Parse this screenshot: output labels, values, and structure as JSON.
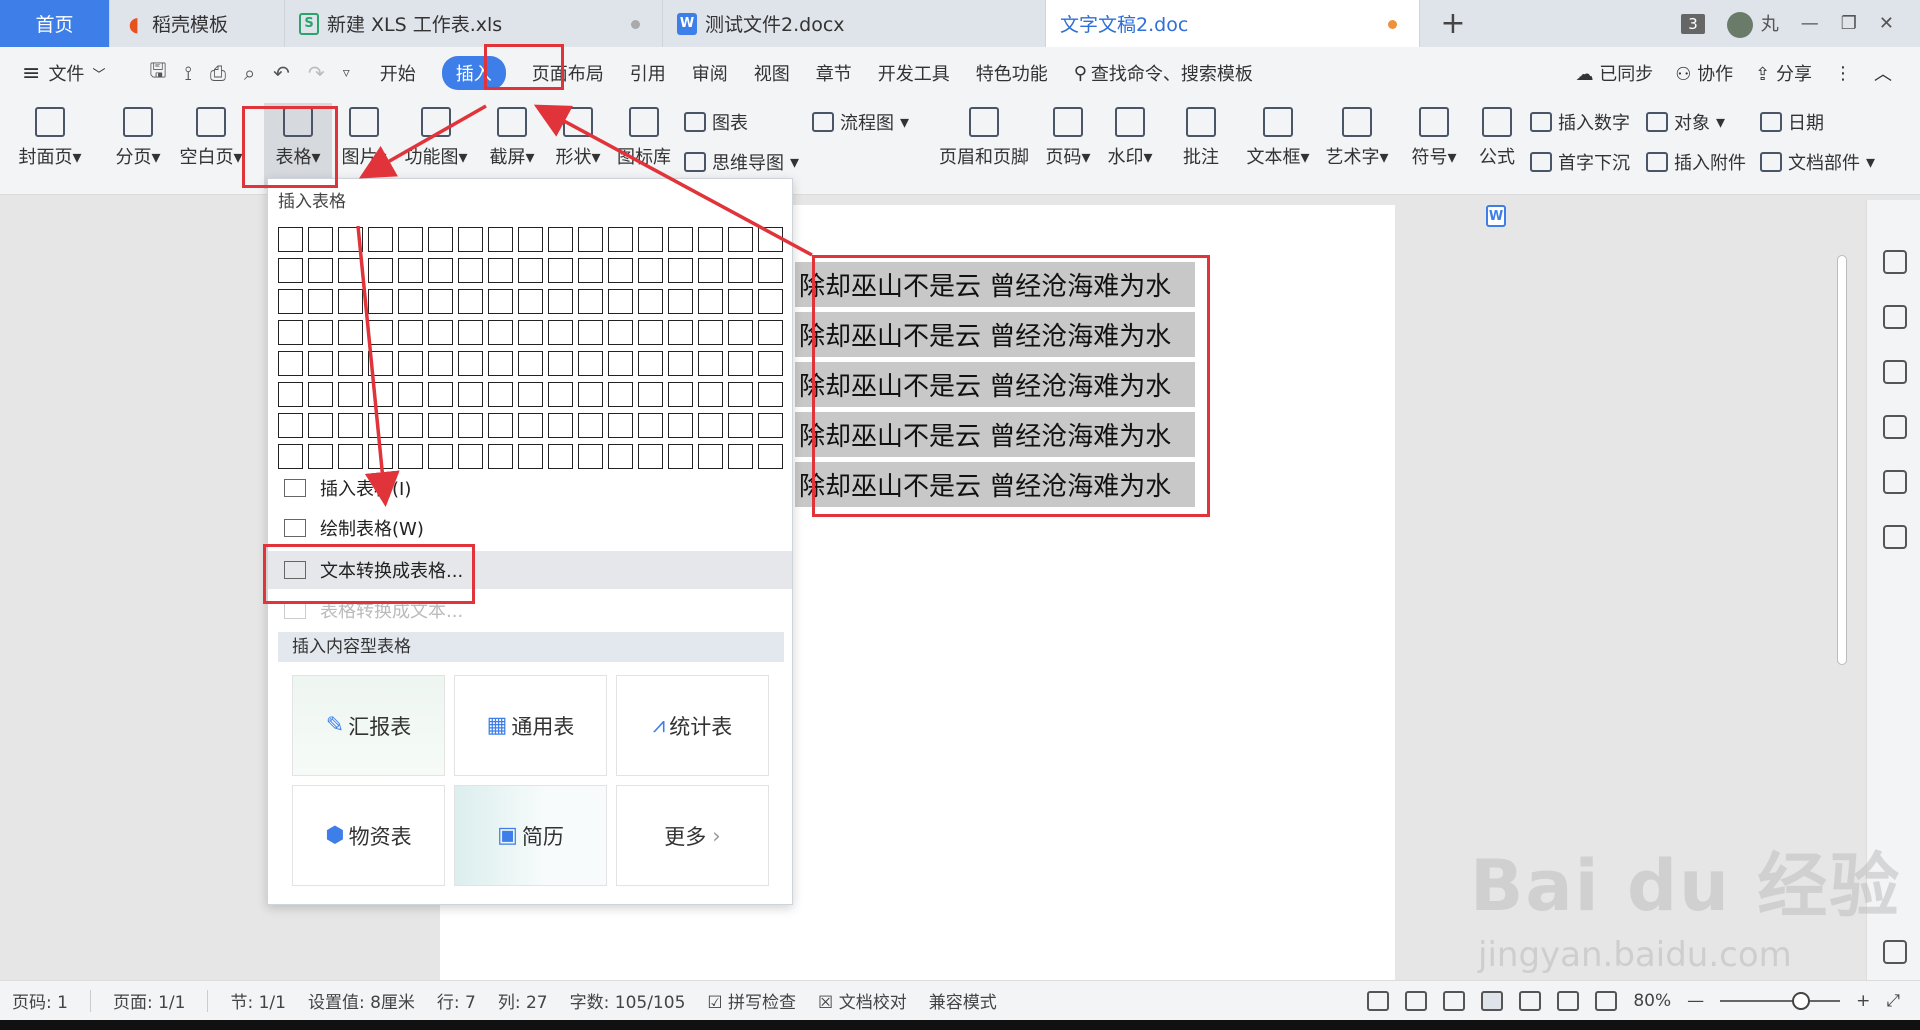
{
  "tabs": [
    {
      "label": "首页",
      "icon": ""
    },
    {
      "label": "稻壳模板",
      "icon": "daoke-icon"
    },
    {
      "label": "新建 XLS 工作表.xls",
      "icon": "xls-file-icon"
    },
    {
      "label": "测试文件2.docx",
      "icon": "docx-file-icon"
    },
    {
      "label": "文字文稿2.doc",
      "icon": "doc-file-icon"
    }
  ],
  "tab_icon_text": {
    "xls": "S",
    "docx": "W",
    "doc": "W"
  },
  "window_count": "3",
  "user_name": "丸",
  "menu": {
    "file": "文件",
    "items": [
      "开始",
      "插入",
      "页面布局",
      "引用",
      "审阅",
      "视图",
      "章节",
      "开发工具",
      "特色功能"
    ],
    "search": "查找命令、搜索模板",
    "synced": "已同步",
    "collab": "协作",
    "share": "分享"
  },
  "ribbon": {
    "cover": "封面页",
    "pagebreak": "分页",
    "blankpage": "空白页",
    "table": "表格",
    "picture": "图片",
    "funcmap": "功能图",
    "screenshot": "截屏",
    "shape": "形状",
    "iconlib": "图标库",
    "chart": "图表",
    "mindmap": "思维导图",
    "flowchart": "流程图",
    "headerfooter": "页眉和页脚",
    "pagenum": "页码",
    "watermark": "水印",
    "comment": "批注",
    "textbox": "文本框",
    "wordart": "艺术字",
    "symbol": "符号",
    "formula": "公式",
    "insertnum": "插入数字",
    "dropcap": "首字下沉",
    "object": "对象",
    "attachment": "插入附件",
    "date": "日期",
    "docpart": "文档部件"
  },
  "document_lines": [
    "除却巫山不是云  曾经沧海难为水",
    "除却巫山不是云  曾经沧海难为水",
    "除却巫山不是云  曾经沧海难为水",
    "除却巫山不是云  曾经沧海难为水",
    "除却巫山不是云  曾经沧海难为水"
  ],
  "dropdown": {
    "title": "插入表格",
    "insert_table": "插入表格(I)",
    "draw_table": "绘制表格(W)",
    "text_to_table": "文本转换成表格...",
    "table_to_text": "表格转换成文本...",
    "content_tables_header": "插入内容型表格",
    "templates": [
      "汇报表",
      "通用表",
      "统计表",
      "物资表",
      "简历",
      "更多"
    ]
  },
  "statusbar": {
    "page_num": "页码: 1",
    "pages": "页面: 1/1",
    "section": "节: 1/1",
    "setting": "设置值: 8厘米",
    "row": "行: 7",
    "col": "列: 27",
    "wordcount": "字数: 105/105",
    "spellcheck": "拼写检查",
    "proofread": "文档校对",
    "compat": "兼容模式",
    "zoom": "80%"
  },
  "watermark": {
    "brand": "Bai  du 经验",
    "url": "jingyan.baidu.com"
  },
  "colors": {
    "accent": "#3d7ee8",
    "annotation": "#e0343a"
  }
}
